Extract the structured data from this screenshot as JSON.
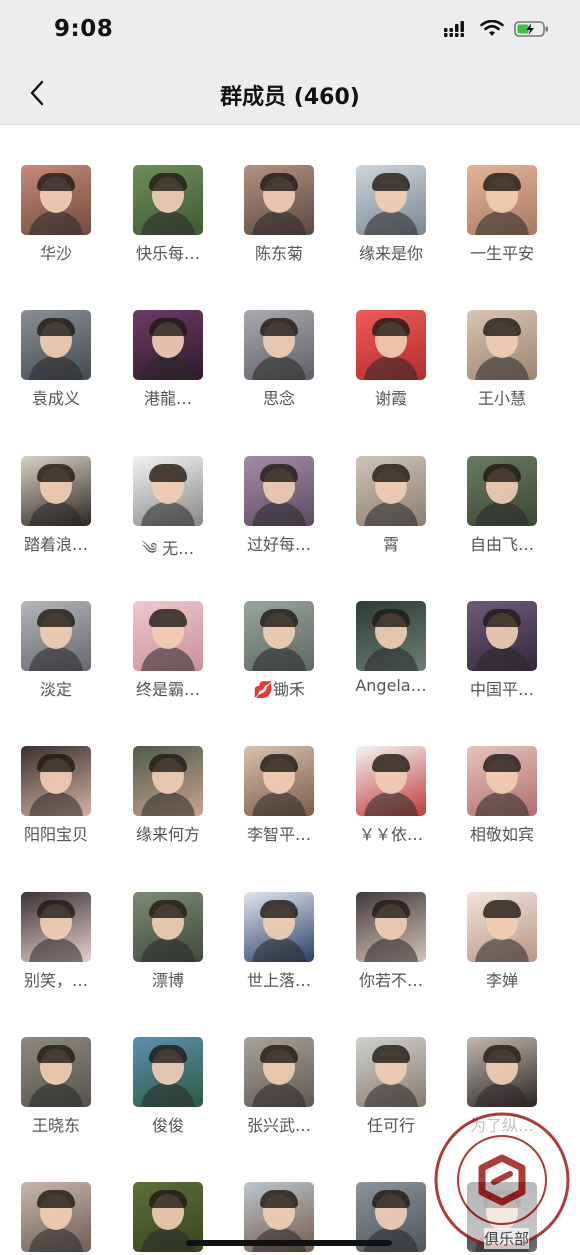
{
  "status_bar": {
    "time": "9:08",
    "icons": [
      "signal-icon",
      "wifi-icon",
      "battery-charging-icon"
    ]
  },
  "header": {
    "back_icon": "chevron-left-icon",
    "title": "群成员 (460)"
  },
  "members": [
    {
      "name": "华沙"
    },
    {
      "name": "快乐每…"
    },
    {
      "name": "陈东菊"
    },
    {
      "name": "缘来是你"
    },
    {
      "name": "一生平安"
    },
    {
      "name": "袁成义"
    },
    {
      "name": "港龍…"
    },
    {
      "name": "思念"
    },
    {
      "name": "谢霞"
    },
    {
      "name": "王小慧"
    },
    {
      "name": "踏着浪…"
    },
    {
      "name": "༄ 无…"
    },
    {
      "name": "过好每…"
    },
    {
      "name": "霄"
    },
    {
      "name": "自由飞…"
    },
    {
      "name": "淡定"
    },
    {
      "name": "终是霸…"
    },
    {
      "name": "💋锄禾"
    },
    {
      "name": "Angela…"
    },
    {
      "name": "中国平…"
    },
    {
      "name": "阳阳宝贝"
    },
    {
      "name": "缘来何方"
    },
    {
      "name": "李智平…"
    },
    {
      "name": "￥￥依…"
    },
    {
      "name": "相敬如宾"
    },
    {
      "name": "别笑，…"
    },
    {
      "name": "漂博"
    },
    {
      "name": "世上落…"
    },
    {
      "name": "你若不…"
    },
    {
      "name": "李婵"
    },
    {
      "name": "王晓东"
    },
    {
      "name": "俊俊"
    },
    {
      "name": "张兴武…"
    },
    {
      "name": "任可行"
    },
    {
      "name": "为了纵…"
    },
    {
      "name": ""
    },
    {
      "name": ""
    },
    {
      "name": ""
    },
    {
      "name": ""
    },
    {
      "name": ""
    }
  ],
  "watermark": {
    "text": "俱乐部"
  }
}
